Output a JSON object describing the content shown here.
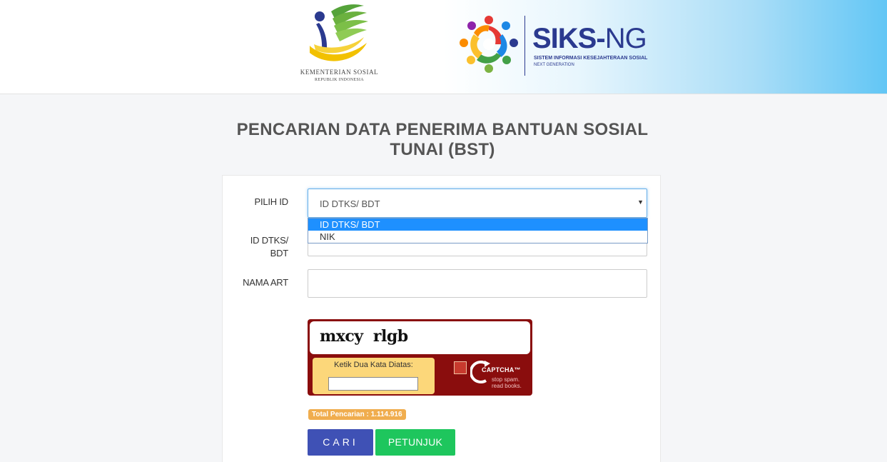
{
  "header": {
    "kemensos": {
      "line1": "KEMENTERIAN SOSIAL",
      "line2": "REPUBLIK INDONESIA"
    },
    "siks": {
      "brand_a": "SIKS-",
      "brand_b": "NG",
      "sub1": "SISTEM INFORMASI KESEJAHTERAAN SOSIAL",
      "sub2": "NEXT GENERATION"
    }
  },
  "page": {
    "title": "PENCARIAN DATA PENERIMA BANTUAN SOSIAL TUNAI (BST)"
  },
  "form": {
    "pilih_id_label": "PILIH ID",
    "id_label": "ID DTKS/ BDT",
    "nama_label": "NAMA ART",
    "select_value": "ID DTKS/ BDT",
    "options": [
      "ID DTKS/ BDT",
      "NIK"
    ],
    "id_value": "",
    "nama_value": ""
  },
  "captcha": {
    "words": "mxcy  rlgb",
    "prompt": "Ketik Dua Kata Diatas:",
    "brand": "CAPTCHA™",
    "tagline_1": "stop spam.",
    "tagline_2": "read books."
  },
  "stats": {
    "total_label": "Total Pencarian : 1.114.916"
  },
  "buttons": {
    "cari": "CARI",
    "petunjuk": "PETUNJUK"
  },
  "colors": {
    "primary": "#3f51b5",
    "success": "#1ec65d",
    "captcha_bg": "#8a0d0d",
    "badge": "#f0ad4e",
    "brand": "#2b3a8f"
  }
}
